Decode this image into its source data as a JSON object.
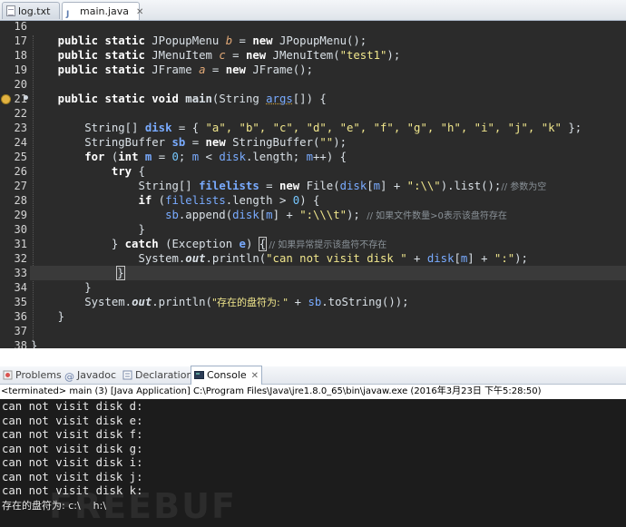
{
  "tabs": [
    {
      "label": "log.txt",
      "active": false
    },
    {
      "label": "main.java",
      "active": true
    }
  ],
  "editor": {
    "line_numbers": [
      "16",
      "17",
      "18",
      "19",
      "20",
      "21",
      "22",
      "23",
      "24",
      "25",
      "26",
      "27",
      "28",
      "29",
      "30",
      "31",
      "32",
      "33",
      "34",
      "35",
      "36",
      "37",
      "38"
    ],
    "lines": {
      "l17": {
        "kw": "public static",
        "type": " JPopupMenu ",
        "fld": "b",
        "rest1": " = ",
        "kw2": "new",
        "rest2": " JPopupMenu();"
      },
      "l18": {
        "kw": "public static",
        "type": " JMenuItem ",
        "fld": "c",
        "rest1": " = ",
        "kw2": "new",
        "rest2": " JMenuItem(",
        "str": "\"test1\"",
        "rest3": ");"
      },
      "l19": {
        "kw": "public static",
        "type": " JFrame ",
        "fld": "a",
        "rest1": " = ",
        "kw2": "new",
        "rest2": " JFrame();"
      },
      "l21": {
        "kw": "public static void",
        "mth": " main",
        "rest1": "(String ",
        "vr": "args",
        "rest2": "[]) {"
      },
      "l23": {
        "rest1": "String[] ",
        "vr": "disk",
        "rest2": " = { ",
        "strs": "\"a\", \"b\", \"c\", \"d\", \"e\", \"f\", \"g\", \"h\", \"i\", \"j\", \"k\"",
        "rest3": " };"
      },
      "l24": {
        "rest1": "StringBuffer ",
        "vr": "sb",
        "rest2": " = ",
        "kw": "new",
        "rest3": " StringBuffer(",
        "str": "\"\"",
        "rest4": ");"
      },
      "l25": {
        "kw": "for",
        "rest1": " (",
        "kw2": "int",
        "rest2": " ",
        "vr": "m",
        "rest3": " = ",
        "num": "0",
        "rest4": "; ",
        "vr2": "m",
        "rest5": " < ",
        "vr3": "disk",
        "rest6": ".length; ",
        "vr4": "m",
        "rest7": "++) {"
      },
      "l26": {
        "kw": "try",
        "rest1": " {"
      },
      "l27": {
        "rest1": "String[] ",
        "vr": "filelists",
        "rest2": " = ",
        "kw": "new",
        "rest3": " File(",
        "vr2": "disk",
        "rest4": "[",
        "vr3": "m",
        "rest5": "] + ",
        "str": "\":\\\\\"",
        "rest6": ").list();",
        "cmt": "// 参数为空"
      },
      "l28": {
        "kw": "if",
        "rest1": " (",
        "vr": "filelists",
        "rest2": ".length > ",
        "num": "0",
        "rest3": ") {"
      },
      "l29": {
        "vr": "sb",
        "rest1": ".append(",
        "vr2": "disk",
        "rest2": "[",
        "vr3": "m",
        "rest3": "] + ",
        "str": "\":\\\\\\t\"",
        "rest4": "); ",
        "cmt": "// 如果文件数量>0表示该盘符存在"
      },
      "l30": {
        "rest1": "}"
      },
      "l31": {
        "rest1": "} ",
        "kw": "catch",
        "rest2": " (Exception ",
        "vr": "e",
        "rest3": ") ",
        "brace": "{",
        "cmt": " // 如果异常提示该盘符不存在"
      },
      "l32": {
        "rest1": "System.",
        "sfld": "out",
        "rest2": ".println(",
        "str": "\"can not visit disk \"",
        "rest3": " + ",
        "vr": "disk",
        "rest4": "[",
        "vr2": "m",
        "rest5": "] + ",
        "str2": "\":\"",
        "rest6": ");"
      },
      "l33": {
        "brace": "}"
      },
      "l34": {
        "rest1": "}"
      },
      "l35": {
        "rest1": "System.",
        "sfld": "out",
        "rest2": ".println(",
        "str": "\"存在的盘符为: \"",
        "rest3": " + ",
        "vr": "sb",
        "rest4": ".toString());"
      },
      "l36": {
        "rest1": "}"
      },
      "l38": {
        "rest1": "}"
      }
    }
  },
  "views": {
    "problems": "Problems",
    "javadoc": "Javadoc",
    "declaration": "Declaration",
    "console": "Console"
  },
  "console": {
    "title": "<terminated> main (3) [Java Application] C:\\Program Files\\Java\\jre1.8.0_65\\bin\\javaw.exe (2016年3月23日 下午5:28:50)",
    "output": [
      "can not visit disk d:",
      "can not visit disk e:",
      "can not visit disk f:",
      "can not visit disk g:",
      "can not visit disk i:",
      "can not visit disk j:",
      "can not visit disk k:"
    ],
    "result": "存在的盘符为: c:\\    h:\\",
    "watermark": "FREEBUF"
  }
}
